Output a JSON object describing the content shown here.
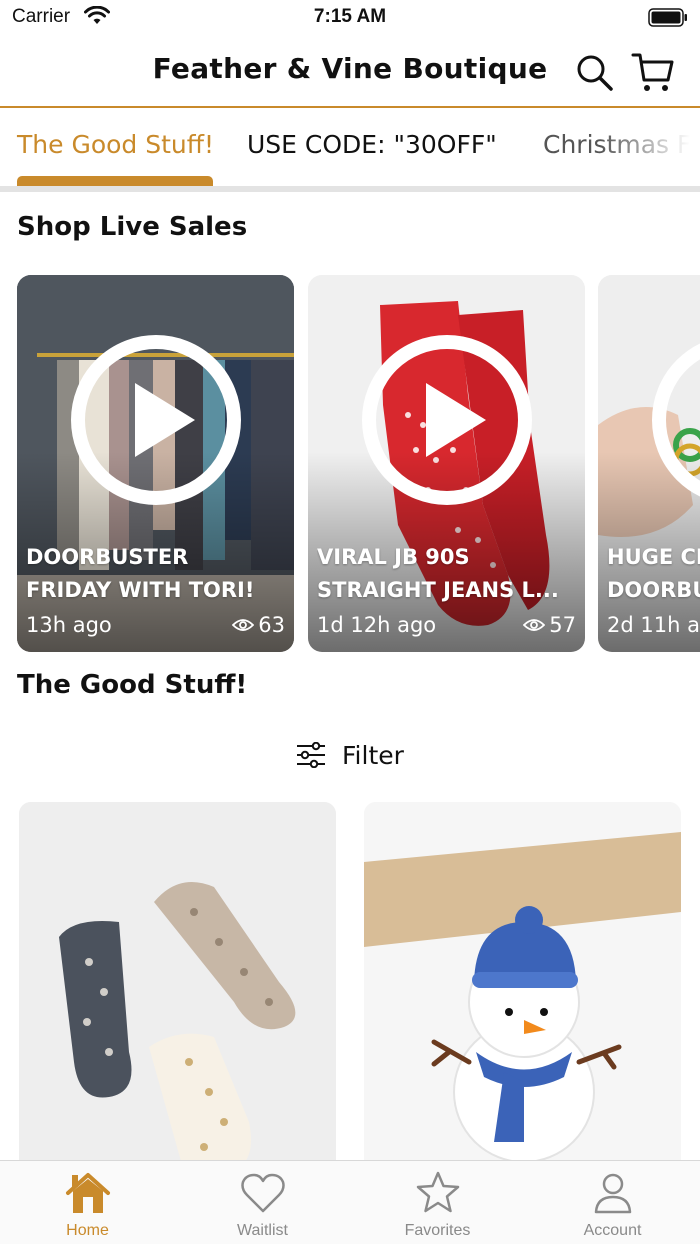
{
  "status_bar": {
    "carrier": "Carrier",
    "time": "7:15 AM"
  },
  "header": {
    "title": "Feather & Vine Boutique",
    "search_icon": "search-icon",
    "cart_icon": "cart-icon"
  },
  "tabs": [
    {
      "label": "The Good Stuff!",
      "active": true
    },
    {
      "label": "USE CODE: \"30OFF\"",
      "active": false
    },
    {
      "label": "Christmas F",
      "active": false
    }
  ],
  "sections": {
    "live_title": "Shop Live Sales",
    "goods_title": "The Good Stuff!"
  },
  "live_sales": [
    {
      "line1": "DOORBUSTER",
      "line2": "FRIDAY WITH TORI!",
      "ago": "13h ago",
      "views": "63"
    },
    {
      "line1": "VIRAL JB 90S",
      "line2": "STRAIGHT JEANS L...",
      "ago": "1d 12h ago",
      "views": "57"
    },
    {
      "line1": "HUGE CH",
      "line2": "DOORBU",
      "ago": "2d 11h a",
      "views": ""
    }
  ],
  "filter": {
    "label": "Filter",
    "icon": "sliders-icon"
  },
  "bottom_nav": [
    {
      "label": "Home",
      "icon": "home-icon",
      "active": true
    },
    {
      "label": "Waitlist",
      "icon": "heart-icon",
      "active": false
    },
    {
      "label": "Favorites",
      "icon": "star-icon",
      "active": false
    },
    {
      "label": "Account",
      "icon": "person-icon",
      "active": false
    }
  ],
  "colors": {
    "accent": "#c98a2b",
    "inactive": "#8a8a8a"
  }
}
